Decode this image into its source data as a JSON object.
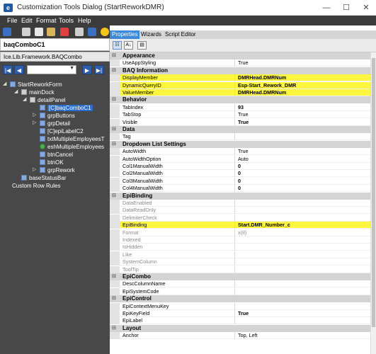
{
  "window": {
    "title": "Customization Tools Dialog  (StartReworkDMR)",
    "minimize": "—",
    "maximize": "☐",
    "close": "✕"
  },
  "menu": [
    "File",
    "Edit",
    "Format",
    "Tools",
    "Help"
  ],
  "left": {
    "control_name": "baqComboC1",
    "control_type": "Ice.Lib.Framework.BAQCombo",
    "tree": [
      {
        "label": "StartReworkForm",
        "level": 0
      },
      {
        "label": "mainDock",
        "level": 1
      },
      {
        "label": "detailPanel",
        "level": 2
      },
      {
        "label": "[C]baqComboC1",
        "level": 3,
        "selected": true
      },
      {
        "label": "grpButtons",
        "level": 3
      },
      {
        "label": "grpDetail",
        "level": 3
      },
      {
        "label": "[C]epiLabelC2",
        "level": 3
      },
      {
        "label": "txtMultipleEmployeesT",
        "level": 3
      },
      {
        "label": "eshMultipleEmployees",
        "level": 3
      },
      {
        "label": "btnCancel",
        "level": 3
      },
      {
        "label": "btnOK",
        "level": 3
      },
      {
        "label": "grpRework",
        "level": 3
      },
      {
        "label": "baseStatusBar",
        "level": 1
      },
      {
        "label": "Custom Row Rules",
        "level": 0
      }
    ]
  },
  "tabs": {
    "properties": "Properties",
    "wizards": "Wizards",
    "script_editor": "Script Editor"
  },
  "property_toolbar": {
    "categorized": "☷",
    "alphabetical": "A↓",
    "pages": "▤"
  },
  "properties": [
    {
      "type": "cat",
      "label": "Appearance"
    },
    {
      "name": "UseAppStyling",
      "value": "True"
    },
    {
      "type": "cat",
      "label": "BAQ Information"
    },
    {
      "name": "DisplayMember",
      "value": "DMRHead.DMRNum",
      "bold": true,
      "highlight": true
    },
    {
      "name": "DynamicQueryID",
      "value": "Esp-Start_Rework_DMR",
      "bold": true,
      "highlight": true
    },
    {
      "name": "ValueMember",
      "value": "DMRHead.DMRNum",
      "bold": true,
      "highlight": true
    },
    {
      "type": "cat",
      "label": "Behavior"
    },
    {
      "name": "TabIndex",
      "value": "93",
      "bold": true
    },
    {
      "name": "TabStop",
      "value": "True"
    },
    {
      "name": "Visible",
      "value": "True",
      "bold": true
    },
    {
      "type": "cat",
      "label": "Data"
    },
    {
      "name": "Tag",
      "value": ""
    },
    {
      "type": "cat",
      "label": "Dropdown List Settings"
    },
    {
      "name": "AutoWidth",
      "value": "True"
    },
    {
      "name": "AutoWidthOption",
      "value": "Auto"
    },
    {
      "name": "Col1ManualWidth",
      "value": "0",
      "bold": true
    },
    {
      "name": "Col2ManualWidth",
      "value": "0",
      "bold": true
    },
    {
      "name": "Col3ManualWidth",
      "value": "0",
      "bold": true
    },
    {
      "name": "Col4ManualWidth",
      "value": "0",
      "bold": true
    },
    {
      "type": "cat",
      "label": "EpiBinding"
    },
    {
      "name": "DataEnabled",
      "value": "",
      "disabled": true
    },
    {
      "name": "DataReadOnly",
      "value": "",
      "disabled": true
    },
    {
      "name": "DelimiterCheck",
      "value": "",
      "disabled": true
    },
    {
      "name": "EpiBinding",
      "value": "Start.DMR_Number_c",
      "bold": true,
      "highlight": true
    },
    {
      "name": "Format",
      "value": "x(8)",
      "disabled": true
    },
    {
      "name": "Indexed",
      "value": "",
      "disabled": true
    },
    {
      "name": "IsHidden",
      "value": "",
      "disabled": true
    },
    {
      "name": "Like",
      "value": "",
      "disabled": true
    },
    {
      "name": "SystemColumn",
      "value": "",
      "disabled": true
    },
    {
      "name": "ToolTip",
      "value": "",
      "disabled": true
    },
    {
      "type": "cat",
      "label": "EpiCombo"
    },
    {
      "name": "DescColumnName",
      "value": ""
    },
    {
      "name": "EpiSystemCode",
      "value": ""
    },
    {
      "type": "cat",
      "label": "EpiControl"
    },
    {
      "name": "EpiContextMenuKey",
      "value": ""
    },
    {
      "name": "EpiKeyField",
      "value": "True",
      "bold": true
    },
    {
      "name": "EpiLabel",
      "value": ""
    },
    {
      "type": "cat",
      "label": "Layout"
    },
    {
      "name": "Anchor",
      "value": "Top, Left"
    }
  ],
  "colors": {
    "highlight": "#fff640",
    "dark_panel": "#484848",
    "tab_active": "#3c8ad8"
  }
}
